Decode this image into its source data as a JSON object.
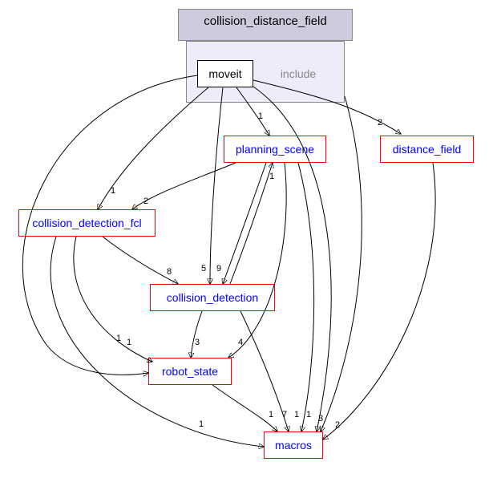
{
  "chart_data": {
    "type": "graph",
    "title": "",
    "nodes": [
      {
        "id": "collision_distance_field",
        "label": "collision_distance_field"
      },
      {
        "id": "moveit",
        "label": "moveit"
      },
      {
        "id": "include",
        "label": "include"
      },
      {
        "id": "planning_scene",
        "label": "planning_scene"
      },
      {
        "id": "distance_field",
        "label": "distance_field"
      },
      {
        "id": "collision_detection_fcl",
        "label": "collision_detection_fcl"
      },
      {
        "id": "collision_detection",
        "label": "collision_detection"
      },
      {
        "id": "robot_state",
        "label": "robot_state"
      },
      {
        "id": "macros",
        "label": "macros"
      }
    ],
    "edges": [
      {
        "from": "moveit",
        "to": "planning_scene",
        "weight": 1
      },
      {
        "from": "moveit",
        "to": "distance_field",
        "weight": 2
      },
      {
        "from": "moveit",
        "to": "collision_detection_fcl",
        "weight": 1
      },
      {
        "from": "moveit",
        "to": "collision_detection",
        "weight": 5
      },
      {
        "from": "moveit",
        "to": "robot_state",
        "weight": 1
      },
      {
        "from": "moveit",
        "to": "macros",
        "weight": 1
      },
      {
        "from": "planning_scene",
        "to": "collision_detection_fcl",
        "weight": 2
      },
      {
        "from": "planning_scene",
        "to": "collision_detection",
        "weight": 9
      },
      {
        "from": "planning_scene",
        "to": "robot_state",
        "weight": 4
      },
      {
        "from": "planning_scene",
        "to": "macros",
        "weight": 1
      },
      {
        "from": "collision_detection",
        "to": "planning_scene",
        "weight": 1
      },
      {
        "from": "distance_field",
        "to": "macros",
        "weight": 2
      },
      {
        "from": "collision_detection_fcl",
        "to": "collision_detection",
        "weight": 8
      },
      {
        "from": "collision_detection_fcl",
        "to": "robot_state",
        "weight": 1
      },
      {
        "from": "collision_detection_fcl",
        "to": "macros",
        "weight": 1
      },
      {
        "from": "collision_detection",
        "to": "robot_state",
        "weight": 3
      },
      {
        "from": "collision_detection",
        "to": "macros",
        "weight": 7
      },
      {
        "from": "robot_state",
        "to": "macros",
        "weight": 3
      },
      {
        "from": "include",
        "to": "macros",
        "weight": 1
      }
    ]
  },
  "nodes": {
    "collision_distance_field": "collision_distance_field",
    "moveit": "moveit",
    "include": "include",
    "planning_scene": "planning_scene",
    "distance_field": "distance_field",
    "collision_detection_fcl": "collision_detection_fcl",
    "collision_detection": "collision_detection",
    "robot_state": "robot_state",
    "macros": "macros"
  },
  "weights": {
    "moveit_planning_scene": "1",
    "moveit_distance_field": "2",
    "moveit_cd_fcl": "1",
    "moveit_cd": "5",
    "moveit_robot_state": "1",
    "moveit_macros": "1",
    "ps_cd_fcl": "2",
    "ps_cd": "9",
    "ps_robot_state": "4",
    "ps_macros": "1",
    "cd_ps": "1",
    "df_macros": "2",
    "fcl_cd": "8",
    "fcl_rs": "1",
    "fcl_macros": "1",
    "cd_rs": "3",
    "cd_macros": "7",
    "rs_macros": "3",
    "include_macros": "1"
  }
}
